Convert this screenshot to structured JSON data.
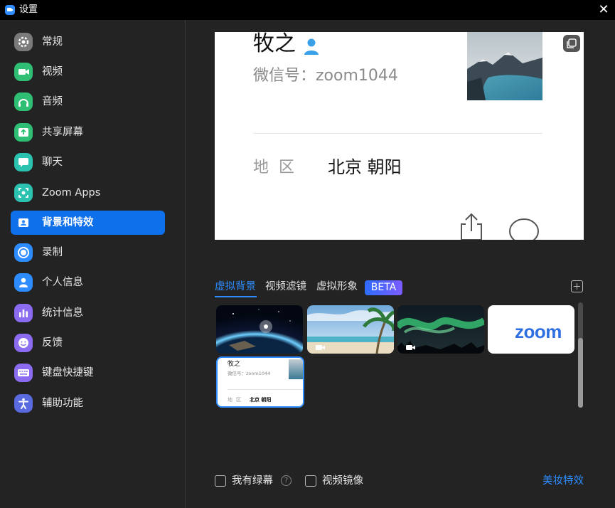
{
  "window": {
    "title": "设置"
  },
  "sidebar": {
    "items": [
      {
        "label": "常规",
        "icon": "gear-icon",
        "color": "#7a7a7a",
        "active": false
      },
      {
        "label": "视频",
        "icon": "video-camera-icon",
        "color": "#2ebf74",
        "active": false
      },
      {
        "label": "音频",
        "icon": "headphones-icon",
        "color": "#2ebf74",
        "active": false
      },
      {
        "label": "共享屏幕",
        "icon": "share-screen-icon",
        "color": "#2ebf74",
        "active": false
      },
      {
        "label": "聊天",
        "icon": "chat-bubble-icon",
        "color": "#2bc2b0",
        "active": false
      },
      {
        "label": "Zoom Apps",
        "icon": "zoom-apps-icon",
        "color": "#2bc2b0",
        "active": false
      },
      {
        "label": "背景和特效",
        "icon": "background-portrait-icon",
        "color": "#2d8cff",
        "active": true
      },
      {
        "label": "录制",
        "icon": "record-icon",
        "color": "#2d8cff",
        "active": false
      },
      {
        "label": "个人信息",
        "icon": "person-icon",
        "color": "#2d8cff",
        "active": false
      },
      {
        "label": "统计信息",
        "icon": "bar-stats-icon",
        "color": "#8b6cf0",
        "active": false
      },
      {
        "label": "反馈",
        "icon": "smiley-icon",
        "color": "#8b6cf0",
        "active": false
      },
      {
        "label": "键盘快捷键",
        "icon": "keyboard-icon",
        "color": "#8b6cf0",
        "active": false
      },
      {
        "label": "辅助功能",
        "icon": "accessibility-icon",
        "color": "#5a6be0",
        "active": false
      }
    ]
  },
  "preview": {
    "name": "牧之",
    "wechat": "微信号：zoom1044",
    "region_label": "地区",
    "region_value": "北京 朝阳"
  },
  "tabs": [
    {
      "label": "虚拟背景",
      "active": true
    },
    {
      "label": "视频滤镜",
      "active": false
    },
    {
      "label": "虚拟形象",
      "active": false
    }
  ],
  "beta_label": "BETA",
  "backgrounds": [
    {
      "id": "earth",
      "name": "earth-background-thumbnail",
      "has_video": false
    },
    {
      "id": "beach",
      "name": "beach-background-thumbnail",
      "has_video": true
    },
    {
      "id": "aurora",
      "name": "aurora-background-thumbnail",
      "has_video": true
    },
    {
      "id": "zoom",
      "name": "zoom-logo-background-thumbnail",
      "has_video": false,
      "logo_text": "zoom"
    },
    {
      "id": "profile",
      "name": "profile-card-background-thumbnail",
      "has_video": false,
      "selected": true
    }
  ],
  "footer": {
    "green_screen": "我有绿幕",
    "mirror_video": "视频镜像",
    "help_glyph": "?",
    "beauty": "美妆特效"
  },
  "colors": {
    "accent": "#2d8cff",
    "active_nav": "#0e71eb",
    "background": "#232323"
  }
}
